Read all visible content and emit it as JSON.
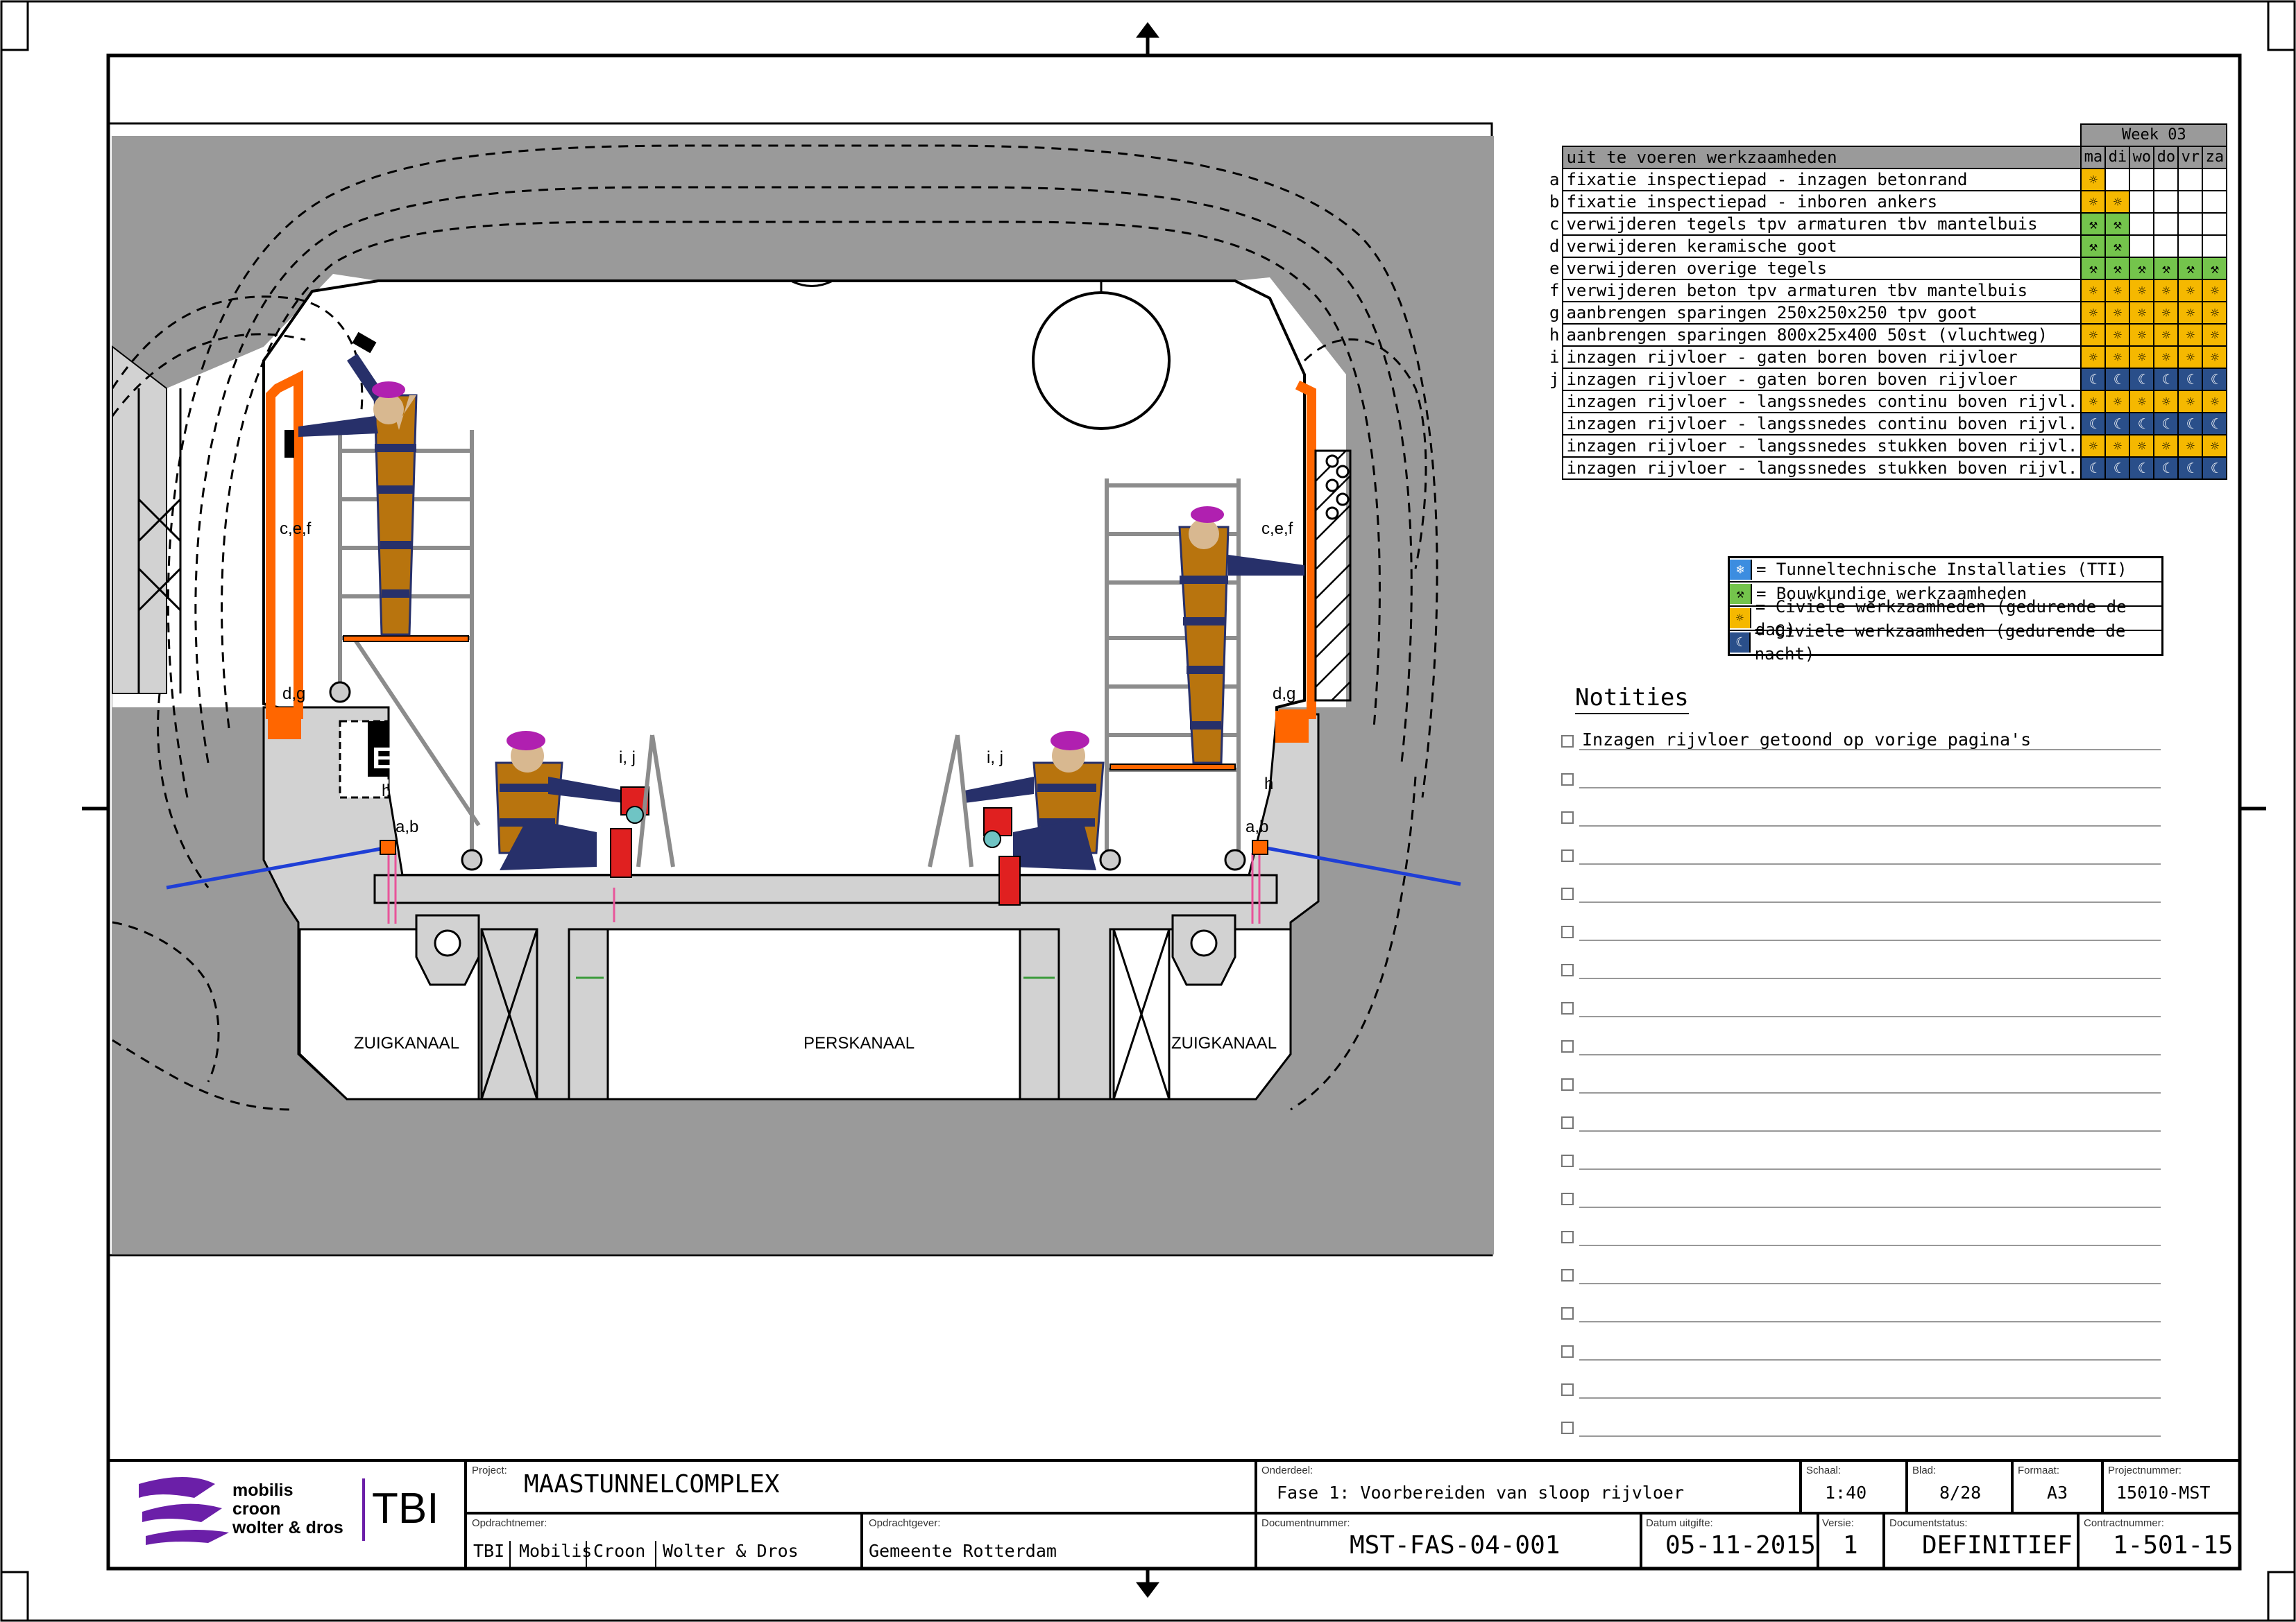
{
  "schedule": {
    "week_label": "Week 03",
    "header_label": "uit te voeren werkzaamheden",
    "days": [
      "ma",
      "di",
      "wo",
      "do",
      "vr",
      "za"
    ],
    "rows": [
      {
        "code": "a",
        "task": "fixatie inspectiepad - inzagen betonrand",
        "cells": [
          "y",
          "",
          "",
          "",
          "",
          ""
        ]
      },
      {
        "code": "b",
        "task": "fixatie inspectiepad - inboren ankers",
        "cells": [
          "y",
          "y",
          "",
          "",
          "",
          ""
        ]
      },
      {
        "code": "c",
        "task": "verwijderen tegels tpv armaturen tbv mantelbuis",
        "cells": [
          "g",
          "g",
          "",
          "",
          "",
          ""
        ]
      },
      {
        "code": "d",
        "task": "verwijderen keramische goot",
        "cells": [
          "g",
          "g",
          "",
          "",
          "",
          ""
        ]
      },
      {
        "code": "e",
        "task": "verwijderen overige tegels",
        "cells": [
          "g",
          "g",
          "g",
          "g",
          "g",
          "g"
        ]
      },
      {
        "code": "f",
        "task": "verwijderen beton tpv armaturen tbv mantelbuis",
        "cells": [
          "y",
          "y",
          "y",
          "y",
          "y",
          "y"
        ]
      },
      {
        "code": "g",
        "task": "aanbrengen sparingen 250x250x250 tpv goot",
        "cells": [
          "y",
          "y",
          "y",
          "y",
          "y",
          "y"
        ]
      },
      {
        "code": "h",
        "task": "aanbrengen sparingen 800x25x400 50st (vluchtweg)",
        "cells": [
          "y",
          "y",
          "y",
          "y",
          "y",
          "y"
        ]
      },
      {
        "code": "i",
        "task": "inzagen rijvloer - gaten boren boven rijvloer",
        "cells": [
          "y",
          "y",
          "y",
          "y",
          "y",
          "y"
        ]
      },
      {
        "code": "j",
        "task": "inzagen rijvloer - gaten boren boven rijvloer",
        "cells": [
          "n",
          "n",
          "n",
          "n",
          "n",
          "n"
        ]
      },
      {
        "code": "",
        "task": "inzagen rijvloer - langssnedes continu boven rijvl.",
        "cells": [
          "y",
          "y",
          "y",
          "y",
          "y",
          "y"
        ]
      },
      {
        "code": "",
        "task": "inzagen rijvloer - langssnedes continu boven rijvl.",
        "cells": [
          "n",
          "n",
          "n",
          "n",
          "n",
          "n"
        ]
      },
      {
        "code": "",
        "task": "inzagen rijvloer - langssnedes stukken boven rijvl.",
        "cells": [
          "y",
          "y",
          "y",
          "y",
          "y",
          "y"
        ]
      },
      {
        "code": "",
        "task": "inzagen rijvloer - langssnedes stukken boven rijvl.",
        "cells": [
          "n",
          "n",
          "n",
          "n",
          "n",
          "n"
        ]
      }
    ]
  },
  "legend": [
    {
      "key": "b",
      "text": "= Tunneltechnische Installaties (TTI)"
    },
    {
      "key": "g",
      "text": "= Bouwkundige werkzaamheden"
    },
    {
      "key": "y",
      "text": "= Civiele werkzaamheden (gedurende de dag)"
    },
    {
      "key": "n",
      "text": "= Civiele werkzaamheden (gedurende de nacht)"
    }
  ],
  "notes": {
    "title": "Notities",
    "items": [
      "Inzagen rijvloer getoond op vorige pagina's",
      "",
      "",
      "",
      "",
      "",
      "",
      "",
      "",
      "",
      "",
      "",
      "",
      "",
      "",
      "",
      "",
      "",
      ""
    ]
  },
  "drawing": {
    "labels": {
      "cef_left": "c,e,f",
      "cef_right": "c,e,f",
      "dg_left": "d,g",
      "dg_right": "d,g",
      "h_left": "h",
      "h_right": "h",
      "ab_left": "a,b",
      "ab_right": "a,b",
      "ij_left": "i, j",
      "ij_right": "i, j",
      "channel_left": "ZUIGKANAAL",
      "channel_mid": "PERSKANAAL",
      "channel_right": "ZUIGKANAAL"
    }
  },
  "titleblock": {
    "logo_lines": [
      "mobilis",
      "croon",
      "wolter & dros"
    ],
    "logo_tbi": "TBI",
    "project_label": "Project:",
    "project": "MAASTUNNELCOMPLEX",
    "onderdeel_label": "Onderdeel:",
    "onderdeel": "Fase 1: Voorbereiden van sloop rijvloer",
    "schaal_label": "Schaal:",
    "schaal": "1:40",
    "blad_label": "Blad:",
    "blad": "8/28",
    "formaat_label": "Formaat:",
    "formaat": "A3",
    "projectnummer_label": "Projectnummer:",
    "projectnummer": "15010-MST",
    "opdrachtnemer_label": "Opdrachtnemer:",
    "opdrachtnemers": [
      "TBI",
      "Mobilis",
      "Croon",
      "Wolter & Dros"
    ],
    "opdrachtgever_label": "Opdrachtgever:",
    "opdrachtgever": "Gemeente Rotterdam",
    "documentnummer_label": "Documentnummer:",
    "documentnummer": "MST-FAS-04-001",
    "datum_label": "Datum uitgifte:",
    "datum": "05-11-2015",
    "versie_label": "Versie:",
    "versie": "1",
    "status_label": "Documentstatus:",
    "status": "DEFINITIEF",
    "contract_label": "Contractnummer:",
    "contract": "1-501-15"
  },
  "colors": {
    "concrete_fill": "#9a9a9a",
    "wall_fill": "#d2d2d2",
    "orange": "#ff6600",
    "worker_body": "#b8740e",
    "worker_stripe": "#27306a",
    "worker_helmet": "#b020b0",
    "blue_line": "#1f3fd6",
    "yellow": "#f5b800",
    "green": "#74c44c",
    "navy": "#2a4f8a"
  }
}
